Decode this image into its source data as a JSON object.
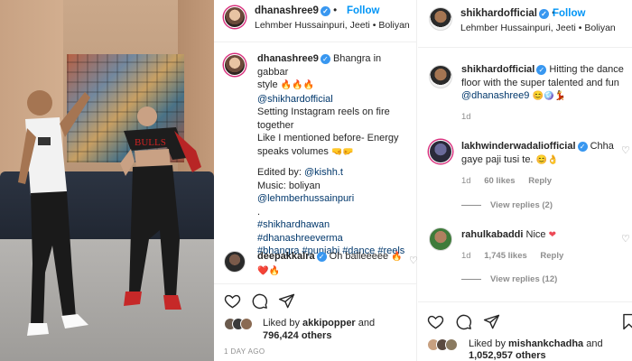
{
  "post": {
    "author": "dhanashree9",
    "follow_label": "Follow",
    "location": "Lehmber Hussainpuri, Jeeti • Boliyan",
    "caption_user": "dhanashree9",
    "caption_lines": {
      "l1": "Bhangra in gabbar",
      "l2": "style",
      "mention": "@shikhardofficial",
      "l3": "Setting Instagram reels on fire",
      "l4": "together",
      "l5": "Like I mentioned before- Energy",
      "l6": "speaks volumes",
      "edited_prefix": "Edited by: ",
      "edited_handle": "@kishh.t",
      "music_prefix": "Music: boliyan ",
      "music_handle": "@lehmberhussainpuri",
      "dot": ".",
      "hashtags_1": "#shikhardhawan #dhanashreeverma",
      "hashtags_2": "#bhangra #punjabi #dance #reels"
    },
    "comment_user": "deepakkalra",
    "comment_text": "Oh balleeeee",
    "liked_by_prefix": "Liked by ",
    "liked_by_user": "akkipopper",
    "liked_by_and": " and",
    "likes_count": "796,424 others",
    "time_ago": "1 DAY AGO"
  },
  "repost": {
    "author": "shikhardofficial",
    "follow_label": "Follow",
    "location": "Lehmber Hussainpuri, Jeeti • Boliyan",
    "caption_user": "shikhardofficial",
    "caption_text": "Hitting the dance floor with the super talented and fun",
    "caption_mention": "@dhanashree9",
    "caption_age": "1d",
    "comments": [
      {
        "user": "lakhwinderwadaliofficial",
        "text": "Chha gaye paji tusi te.",
        "age": "1d",
        "likes": "60 likes",
        "reply": "Reply",
        "view_replies": "View replies (2)"
      },
      {
        "user": "rahulkabaddi",
        "text": "Nice",
        "age": "1d",
        "likes": "1,745 likes",
        "reply": "Reply",
        "view_replies": "View replies (12)"
      }
    ],
    "liked_by_prefix": "Liked by ",
    "liked_by_user": "mishankchadha",
    "liked_by_and": " and",
    "likes_count": "1,052,957 others"
  },
  "colors": {
    "verified": "#3897f0",
    "follow": "#0095f6",
    "link": "#00376b",
    "heart": "#ed4956"
  },
  "icons": [
    "heart-icon",
    "comment-icon",
    "share-icon",
    "bookmark-icon",
    "verified-icon",
    "fire-emoji",
    "heart-emoji"
  ]
}
